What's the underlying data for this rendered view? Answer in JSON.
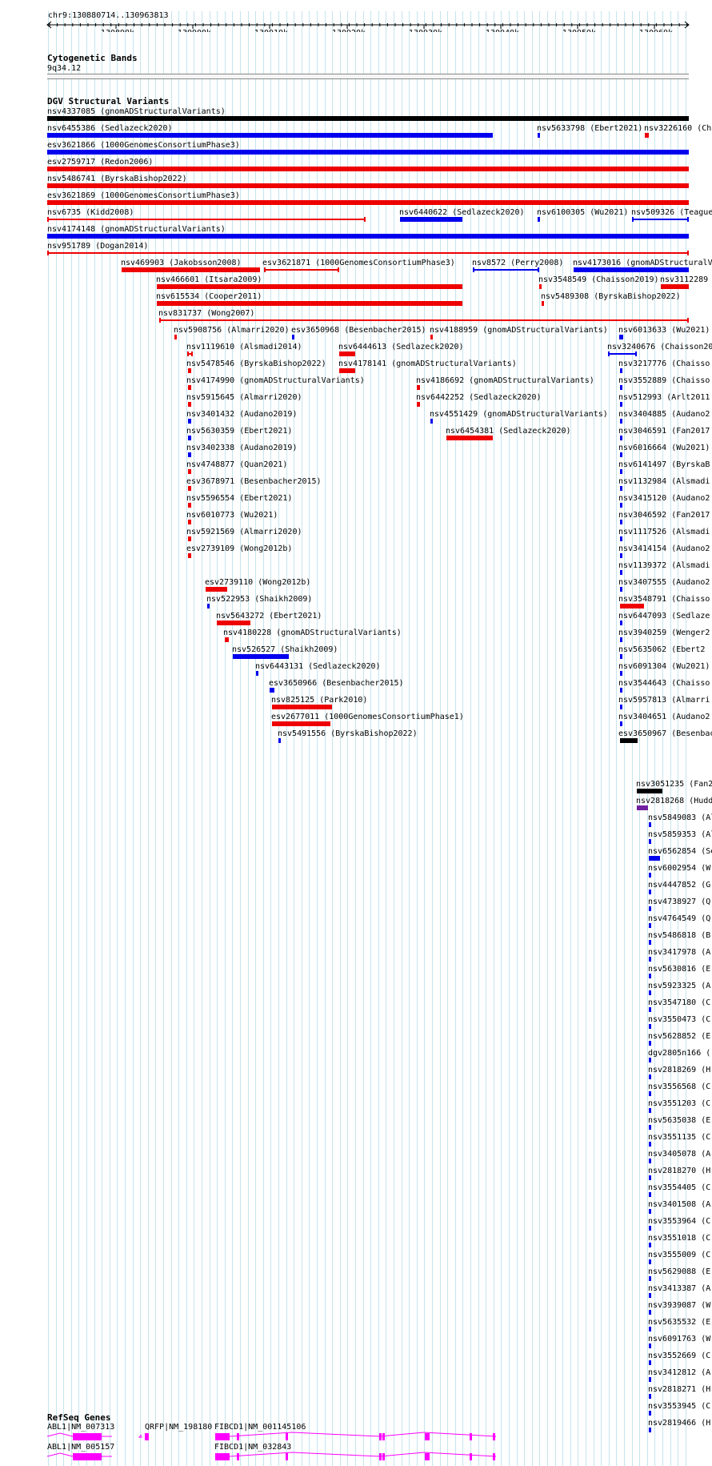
{
  "locus": "chr9:130880714..130963813",
  "ruler_ticks": [
    "130890k",
    "130900k",
    "130910k",
    "130920k",
    "130930k",
    "130940k",
    "130950k",
    "130960k"
  ],
  "cytoband": {
    "title": "Cytogenetic Bands",
    "band": "9q34.12"
  },
  "dgv": {
    "title": "DGV Structural Variants"
  },
  "colors": {
    "gain": "#0000ee",
    "loss": "#ee0000",
    "complex": "#000000",
    "mixed": "#7020a0",
    "grid": "#c4e4ef",
    "gene": "#ff00ff"
  },
  "variant_labels": [
    "nsv4337085 (gnomADStructuralVariants)",
    "nsv6455386 (Sedlazeck2020)",
    "nsv5633798 (Ebert2021)",
    "nsv3226160 (Ch",
    "esv3621866 (1000GenomesConsortiumPhase3)",
    "esv2759717 (Redon2006)",
    "nsv5486741 (ByrskaBishop2022)",
    "esv3621869 (1000GenomesConsortiumPhase3)",
    "nsv6735 (Kidd2008)",
    "nsv6440622 (Sedlazeck2020)",
    "nsv6100305 (Wu2021)",
    "nsv509326 (Teague",
    "nsv4174148 (gnomADStructuralVariants)",
    "nsv951789 (Dogan2014)",
    "nsv469903 (Jakobsson2008)",
    "esv3621871 (1000GenomesConsortiumPhase3)",
    "nsv8572 (Perry2008)",
    "nsv4173016 (gnomADStructuralV",
    "nsv466601 (Itsara2009)",
    "nsv3548549 (Chaisson2019)",
    "nsv3112289",
    "nsv615534 (Cooper2011)",
    "nsv5489308 (ByrskaBishop2022)",
    "nsv831737 (Wong2007)",
    "nsv5908756 (Almarri2020)",
    "esv3650968 (Besenbacher2015)",
    "nsv4188959 (gnomADStructuralVariants)",
    "nsv6013633 (Wu2021)",
    "nsv1119610 (Alsmadi2014)",
    "nsv6444613 (Sedlazeck2020)",
    "nsv3240676 (Chaisson20",
    "nsv5478546 (ByrskaBishop2022)",
    "nsv4178141 (gnomADStructuralVariants)",
    "nsv3217776 (Chaisso",
    "nsv4174990 (gnomADStructuralVariants)",
    "nsv4186692 (gnomADStructuralVariants)",
    "nsv3552889 (Chaisso",
    "nsv5915645 (Almarri2020)",
    "nsv6442252 (Sedlazeck2020)",
    "nsv512993 (Arlt2011",
    "nsv3401432 (Audano2019)",
    "nsv4551429 (gnomADStructuralVariants)",
    "nsv3404885 (Audano2",
    "nsv5630359 (Ebert2021)",
    "nsv6454381 (Sedlazeck2020)",
    "nsv3046591 (Fan2017",
    "nsv3402338 (Audano2019)",
    "nsv6016664 (Wu2021)",
    "nsv4748877 (Quan2021)",
    "nsv6141497 (ByrskaB",
    "esv3678971 (Besenbacher2015)",
    "nsv1132984 (Alsmadi",
    "nsv5596554 (Ebert2021)",
    "nsv3415120 (Audano2",
    "nsv6010773 (Wu2021)",
    "nsv3046592 (Fan2017",
    "nsv5921569 (Almarri2020)",
    "nsv1117526 (Alsmadi",
    "esv2739109 (Wong2012b)",
    "nsv3414154 (Audano2",
    "esv2739110 (Wong2012b)",
    "nsv1139372 (Alsmadi",
    "nsv522953 (Shaikh2009)",
    "nsv3407555 (Audano2",
    "nsv5643272 (Ebert2021)",
    "nsv3548791 (Chaisso",
    "nsv4180228 (gnomADStructuralVariants)",
    "nsv6447093 (Sedlaze",
    "nsv526527 (Shaikh2009)",
    "nsv3940259 (Wenger2",
    "nsv6443131 (Sedlazeck2020)",
    "nsv5635062 (Ebert2",
    "esv3650966 (Besenbacher2015)",
    "nsv6091304 (Wu2021)",
    "nsv825125 (Park2010)",
    "nsv3544643 (Chaisso",
    "esv2677011 (1000GenomesConsortiumPhase1)",
    "nsv5957813 (Almarri",
    "nsv5491556 (ByrskaBishop2022)",
    "nsv3404651 (Audano2",
    "esv3650967 (Besenbacher2015)",
    "nsv3051235 (Fan2017",
    "nsv2818268 (Huddles",
    "nsv5849083 (Almarri",
    "nsv5859353 (Alma",
    "nsv6562854 (Sedl",
    "nsv6002954 (W",
    "nsv4447852 (G",
    "nsv4738927 (Q",
    "nsv4764549 (Q",
    "nsv5486818 (B",
    "nsv3417978 (A",
    "nsv5630816 (E",
    "nsv5923325 (A",
    "nsv3547180 (C",
    "nsv3550473 (C",
    "nsv5628852 (E",
    "dgv2805n166 (",
    "nsv2818269 (H",
    "nsv3556568 (C",
    "nsv3551203 (C",
    "nsv5635038 (E",
    "nsv3551135 (C",
    "nsv3405078 (A",
    "nsv2818270 (H",
    "nsv3554405 (C",
    "nsv3401508 (A",
    "nsv3553964 (C",
    "nsv3551018 (C",
    "nsv3555009 (C",
    "nsv5629088 (E",
    "nsv3413387 (A",
    "nsv3939087 (W",
    "nsv5635532 (E",
    "nsv6091763 (W",
    "nsv3552669 (C",
    "nsv3412812 (A",
    "nsv2818271 (H",
    "nsv3553945 (C",
    "nsv2819466 (H"
  ],
  "refseq": {
    "title": "RefSeq Genes",
    "genes": [
      "ABL1|NM_007313",
      "QRFP|NM_198180",
      "FIBCD1|NM_001145106",
      "ABL1|NM_005157",
      "FIBCD1|NM_032843"
    ]
  }
}
